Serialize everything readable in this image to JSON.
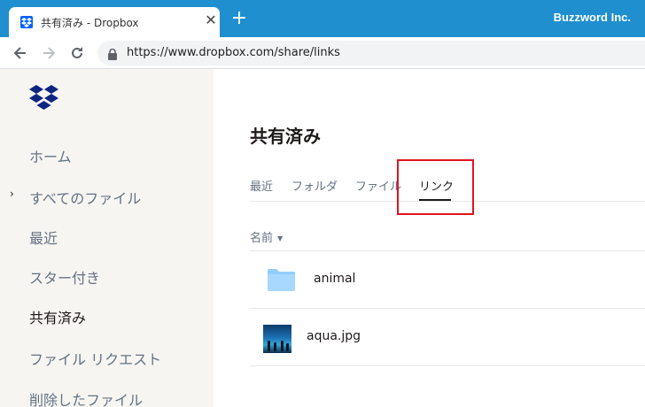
{
  "browser": {
    "tab_title": "共有済み - Dropbox",
    "tab_close": "✕",
    "new_tab": "+",
    "brand": "Buzzword Inc.",
    "url": "https://www.dropbox.com/share/links"
  },
  "sidebar": {
    "items": [
      {
        "label": "ホーム"
      },
      {
        "label": "すべてのファイル"
      },
      {
        "label": "最近"
      },
      {
        "label": "スター付き"
      },
      {
        "label": "共有済み"
      },
      {
        "label": "ファイル リクエスト"
      },
      {
        "label": "削除したファイル"
      }
    ],
    "caret": "›"
  },
  "main": {
    "title": "共有済み",
    "tabs": [
      {
        "label": "最近"
      },
      {
        "label": "フォルダ"
      },
      {
        "label": "ファイル"
      },
      {
        "label": "リンク"
      }
    ],
    "column_header": "名前",
    "sort_icon": "▼",
    "files": [
      {
        "name": "animal",
        "icon": "folder-icon"
      },
      {
        "name": "aqua.jpg",
        "icon": "image-thumbnail"
      }
    ]
  },
  "colors": {
    "titlebar": "#1f8fcf",
    "sidebar_bg": "#f7f5f2",
    "highlight": "#e0141e",
    "dropbox_blue": "#0061fe"
  }
}
